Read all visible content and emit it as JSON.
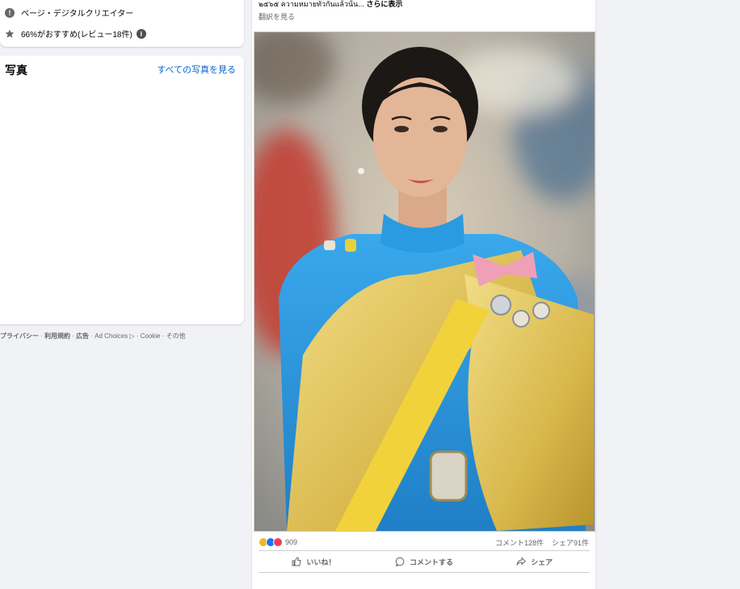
{
  "intro": {
    "category": "ページ・デジタルクリエイター",
    "recommend": "66%がおすすめ(レビュー18件)"
  },
  "photos": {
    "title": "写真",
    "see_all": "すべての写真を見る",
    "thumbs": [
      {
        "name": "photo-1",
        "colors": [
          "#f3c7d4",
          "#1e8fd6",
          "#e8d15a"
        ]
      },
      {
        "name": "photo-2",
        "colors": [
          "#cfd8e2",
          "#5b8f4d",
          "#b13b3b"
        ]
      },
      {
        "name": "photo-3",
        "colors": [
          "#7a3b24",
          "#e0b23a",
          "#c43a2e"
        ]
      },
      {
        "name": "photo-4",
        "colors": [
          "#4b6b3a",
          "#2f7fb9",
          "#e6e6e6"
        ]
      },
      {
        "name": "photo-5",
        "colors": [
          "#5d7d4a",
          "#2f7fb9",
          "#e6e6e6"
        ]
      },
      {
        "name": "photo-6",
        "colors": [
          "#6e8c5a",
          "#2f7fb9",
          "#c0a070"
        ]
      },
      {
        "name": "photo-7",
        "colors": [
          "#4f7a3a",
          "#2f7fb9",
          "#c8b27a"
        ]
      },
      {
        "name": "photo-8",
        "colors": [
          "#b28a5a",
          "#9ab6d8",
          "#d9c8a8"
        ]
      },
      {
        "name": "photo-9",
        "colors": [
          "#6a3a1c",
          "#d9b04a",
          "#b8d2e6"
        ]
      }
    ]
  },
  "footer": {
    "privacy": "プライバシー",
    "terms": "利用規約",
    "ads": "広告",
    "ad_choices": "Ad Choices",
    "cookie": "Cookie",
    "more": "その他"
  },
  "post": {
    "text": "๒๕๖๕ ความหมายทั่วกันแล้วนั้น...",
    "see_more": "さらに表示",
    "translate": "翻訳を見る",
    "reaction_count": "909",
    "comments": "コメント128件",
    "shares": "シェア91件",
    "like_label": "いいね！",
    "comment_label": "コメントする",
    "share_label": "シェア"
  },
  "colors": {
    "link": "#0064d1",
    "secondary_text": "#65676b",
    "dress_blue": "#2a9be0",
    "sash_gold": "#e2c64e"
  }
}
